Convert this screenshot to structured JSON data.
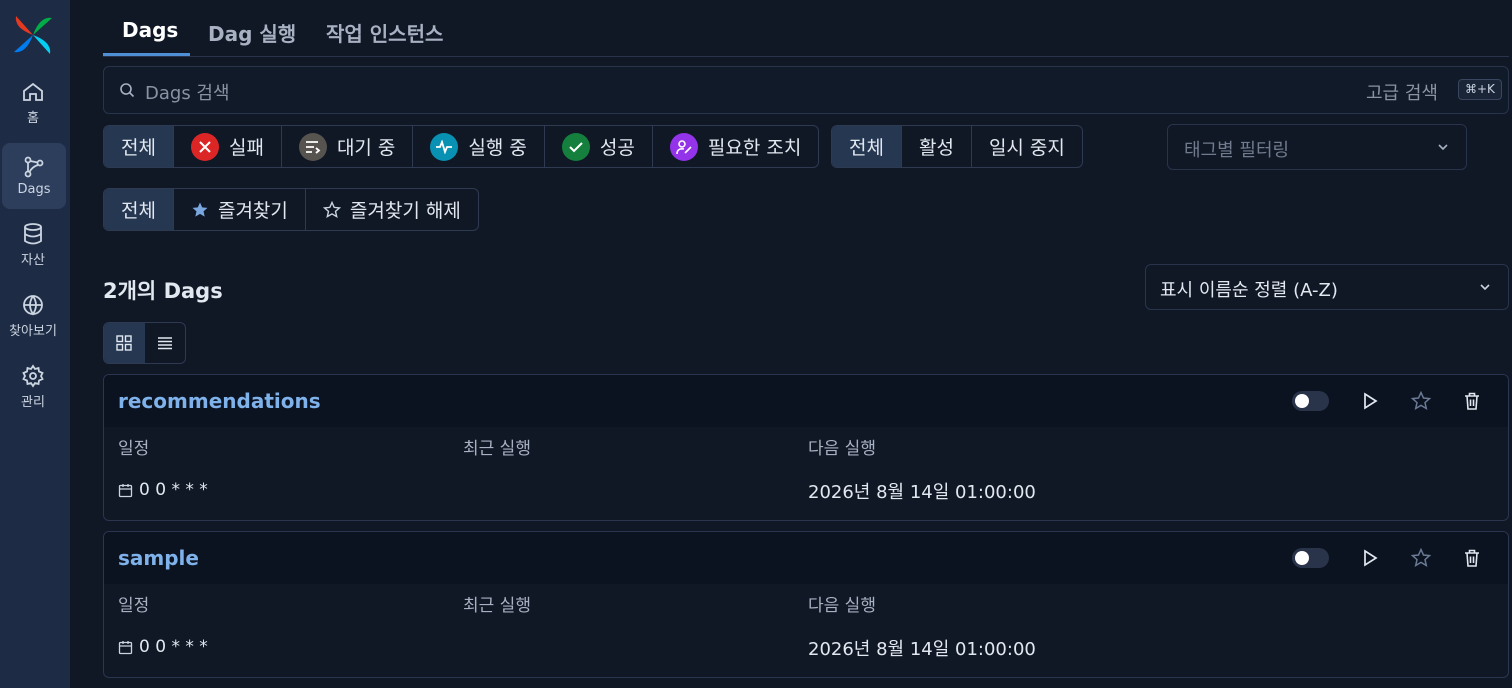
{
  "nav": {
    "items": [
      {
        "label": "홈",
        "icon": "home-icon"
      },
      {
        "label": "Dags",
        "icon": "dags-icon"
      },
      {
        "label": "자산",
        "icon": "database-icon"
      },
      {
        "label": "찾아보기",
        "icon": "globe-icon"
      },
      {
        "label": "관리",
        "icon": "gear-icon"
      }
    ],
    "active": "Dags"
  },
  "tabs": [
    {
      "label": "Dags",
      "active": true
    },
    {
      "label": "Dag 실행",
      "active": false
    },
    {
      "label": "작업 인스턴스",
      "active": false
    }
  ],
  "search": {
    "placeholder": "Dags 검색",
    "advanced_label": "고급 검색",
    "shortcut": "⌘+K"
  },
  "state_filters": [
    {
      "label": "전체",
      "active": true
    },
    {
      "label": "실패",
      "icon": "x-icon",
      "color": "#dc2626"
    },
    {
      "label": "대기 중",
      "icon": "queue-icon",
      "color": "#57534e"
    },
    {
      "label": "실행 중",
      "icon": "pulse-icon",
      "color": "#0891b2"
    },
    {
      "label": "성공",
      "icon": "check-icon",
      "color": "#15803d"
    },
    {
      "label": "필요한 조치",
      "icon": "person-action-icon",
      "color": "#9333ea"
    }
  ],
  "active_filters": [
    {
      "label": "전체",
      "active": true
    },
    {
      "label": "활성"
    },
    {
      "label": "일시 중지"
    }
  ],
  "tag_filter": {
    "placeholder": "태그별 필터링"
  },
  "favorite_filters": [
    {
      "label": "전체",
      "active": true
    },
    {
      "label": "즐겨찾기",
      "icon": "star-filled-icon"
    },
    {
      "label": "즐겨찾기 해제",
      "icon": "star-outline-icon"
    }
  ],
  "dag_count_label": "2개의 Dags",
  "sort": {
    "selected": "표시 이름순 정렬 (A-Z)"
  },
  "view_mode": "card",
  "columns": {
    "schedule": "일정",
    "latest_run": "최근 실행",
    "next_run": "다음 실행"
  },
  "dags": [
    {
      "name": "recommendations",
      "schedule": "0 0 * * *",
      "latest_run": "",
      "next_run": "2026년 8월 14일 01:00:00",
      "paused": true
    },
    {
      "name": "sample",
      "schedule": "0 0 * * *",
      "latest_run": "",
      "next_run": "2026년 8월 14일 01:00:00",
      "paused": true
    }
  ],
  "colors": {
    "accent": "#4f8fd6",
    "sidebar": "#1e2b44",
    "background": "#101826",
    "link": "#7fb2ea"
  }
}
